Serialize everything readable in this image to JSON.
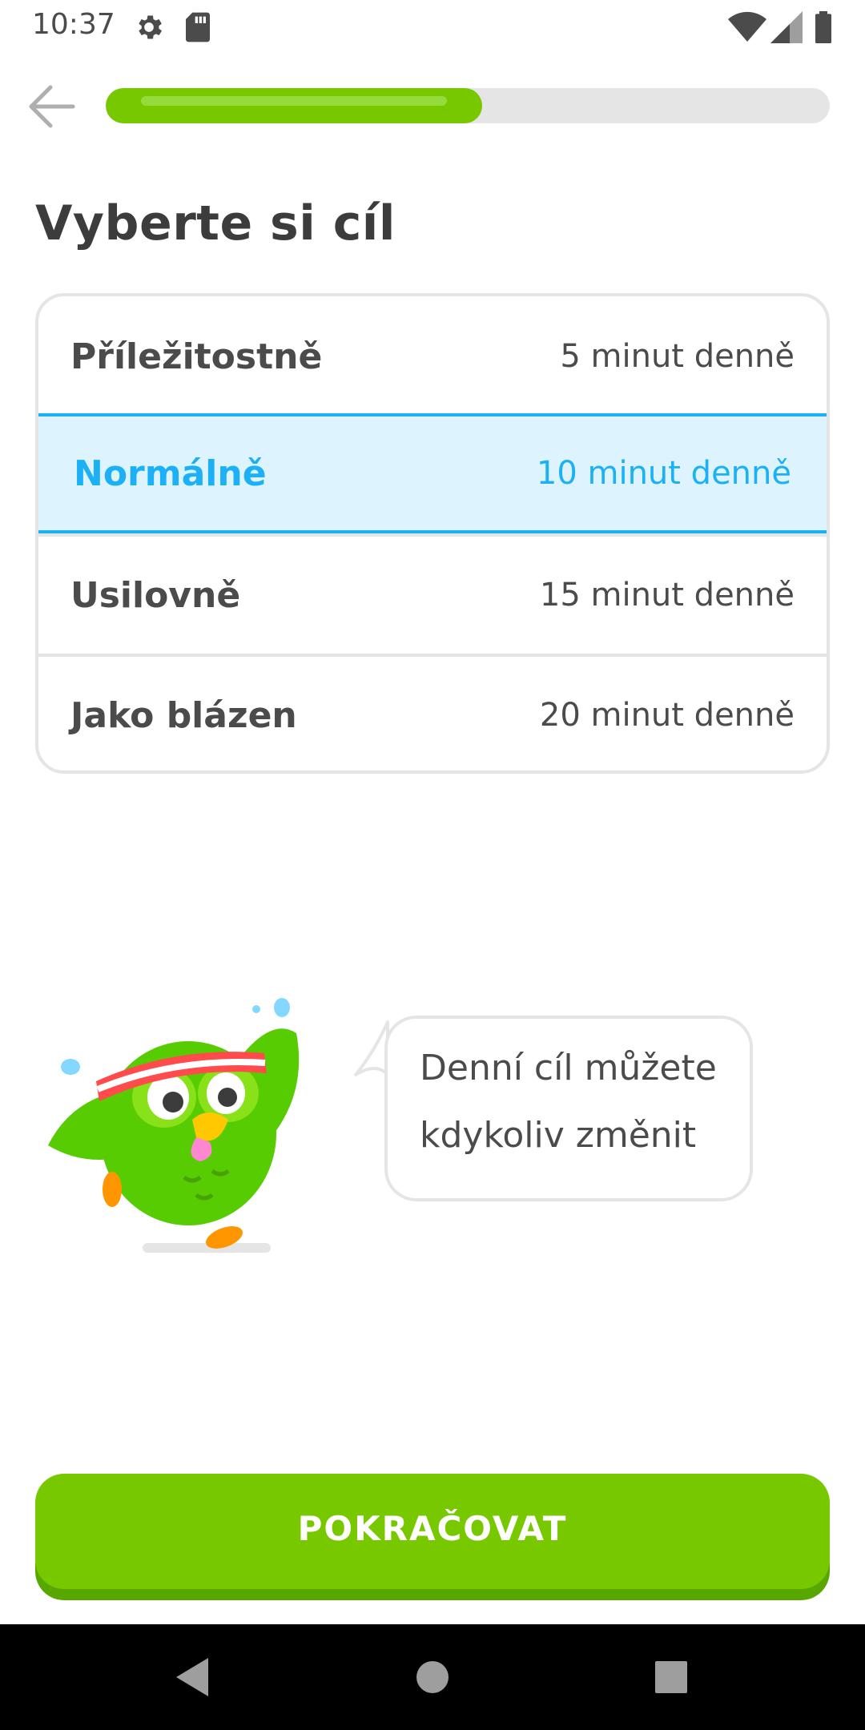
{
  "status_bar": {
    "time": "10:37",
    "icons": [
      "settings-icon",
      "sd-card-icon",
      "wifi-icon",
      "signal-icon",
      "battery-icon"
    ]
  },
  "header": {
    "back_icon": "arrow-left-icon",
    "progress_fraction": 0.52
  },
  "page_title": "Vyberte si cíl",
  "goals": [
    {
      "label": "Příležitostně",
      "value": "5 minut denně",
      "selected": false
    },
    {
      "label": "Normálně",
      "value": "10 minut denně",
      "selected": true
    },
    {
      "label": "Usilovně",
      "value": "15 minut denně",
      "selected": false
    },
    {
      "label": "Jako blázen",
      "value": "20 minut denně",
      "selected": false
    }
  ],
  "speech": {
    "line1": "Denní cíl můžete",
    "line2": "kdykoliv změnit"
  },
  "continue_label": "POKRAČOVAT",
  "colors": {
    "accent_green": "#78c800",
    "accent_green_dark": "#58a700",
    "selected_blue": "#1cb0f6",
    "selected_bg": "#ddf4ff",
    "text_dark": "#4b4b4b",
    "border_gray": "#e5e5e5"
  },
  "nav_bar": {
    "icons": [
      "back-triangle-icon",
      "home-circle-icon",
      "recents-square-icon"
    ]
  }
}
